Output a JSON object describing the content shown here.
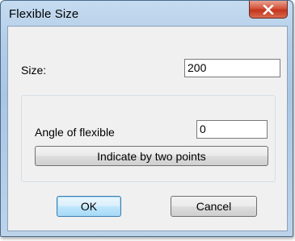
{
  "window": {
    "title": "Flexible Size",
    "close_icon": "close-icon"
  },
  "form": {
    "size_label": "Size:",
    "size_value": "200",
    "angle_label": "Angle of flexible",
    "angle_value": "0",
    "indicate_button_label": "Indicate by two points"
  },
  "buttons": {
    "ok_label": "OK",
    "cancel_label": "Cancel"
  },
  "colors": {
    "close_button": "#c2351c",
    "default_button_border": "#3c7fb1",
    "titlebar": "#b3cde8",
    "client_background": "#f0f0f0"
  }
}
